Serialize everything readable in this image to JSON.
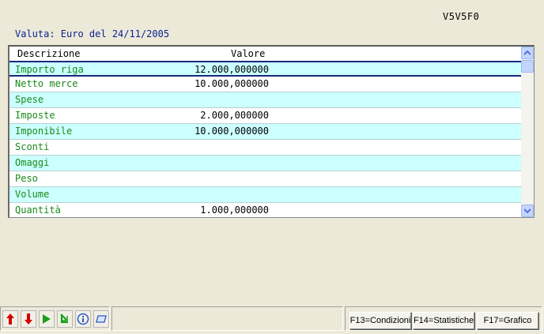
{
  "screen_id": "V5V5F0",
  "currency_line": "Valuta: Euro del 24/11/2005",
  "grid": {
    "columns": {
      "description": "Descrizione",
      "value": "Valore"
    },
    "rows": [
      {
        "description": "Importo riga",
        "value": "12.000,000000"
      },
      {
        "description": "Netto merce",
        "value": "10.000,000000"
      },
      {
        "description": "Spese",
        "value": ""
      },
      {
        "description": "Imposte",
        "value": "2.000,000000"
      },
      {
        "description": "Imponibile",
        "value": "10.000,000000"
      },
      {
        "description": "Sconti",
        "value": ""
      },
      {
        "description": "Omaggi",
        "value": ""
      },
      {
        "description": "Peso",
        "value": ""
      },
      {
        "description": "Volume",
        "value": ""
      },
      {
        "description": "Quantità",
        "value": "1.000,000000"
      }
    ]
  },
  "function_keys": {
    "f13": "F13=Condizioni",
    "f14": "F14=Statistiche",
    "f17": "F17=Grafico"
  },
  "toolbar": [
    "arrow-up-icon",
    "arrow-down-icon",
    "play-icon",
    "refresh-arrow-icon",
    "info-icon",
    "eraser-icon"
  ],
  "colors": {
    "description_text": "#1a8a1a",
    "alt_row": "#ccffff",
    "header_text": "#0a1f8f"
  }
}
